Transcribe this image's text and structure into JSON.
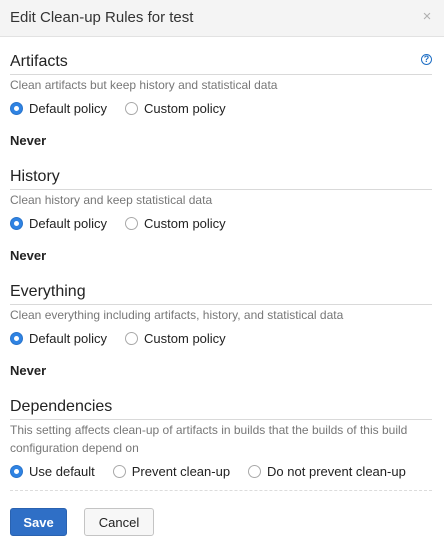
{
  "dialog": {
    "title": "Edit Clean-up Rules for test",
    "close_symbol": "×"
  },
  "sections": [
    {
      "title": "Artifacts",
      "description": "Clean artifacts but keep history and statistical data",
      "options": [
        "Default policy",
        "Custom policy"
      ],
      "selected": 0,
      "value": "Never"
    },
    {
      "title": "History",
      "description": "Clean history and keep statistical data",
      "options": [
        "Default policy",
        "Custom policy"
      ],
      "selected": 0,
      "value": "Never"
    },
    {
      "title": "Everything",
      "description": "Clean everything including artifacts, history, and statistical data",
      "options": [
        "Default policy",
        "Custom policy"
      ],
      "selected": 0,
      "value": "Never"
    },
    {
      "title": "Dependencies",
      "description_line1": "This setting affects clean-up of artifacts in builds that the builds of this build",
      "description_line2": "configuration depend on",
      "options": [
        "Use default",
        "Prevent clean-up",
        "Do not prevent clean-up"
      ],
      "selected": 0
    }
  ],
  "help_icon": "question-mark",
  "buttons": {
    "save": "Save",
    "cancel": "Cancel"
  },
  "colors": {
    "accent": "#2f83e3",
    "save_button": "#2f6fc6",
    "header_bg": "#f4f4f4"
  }
}
